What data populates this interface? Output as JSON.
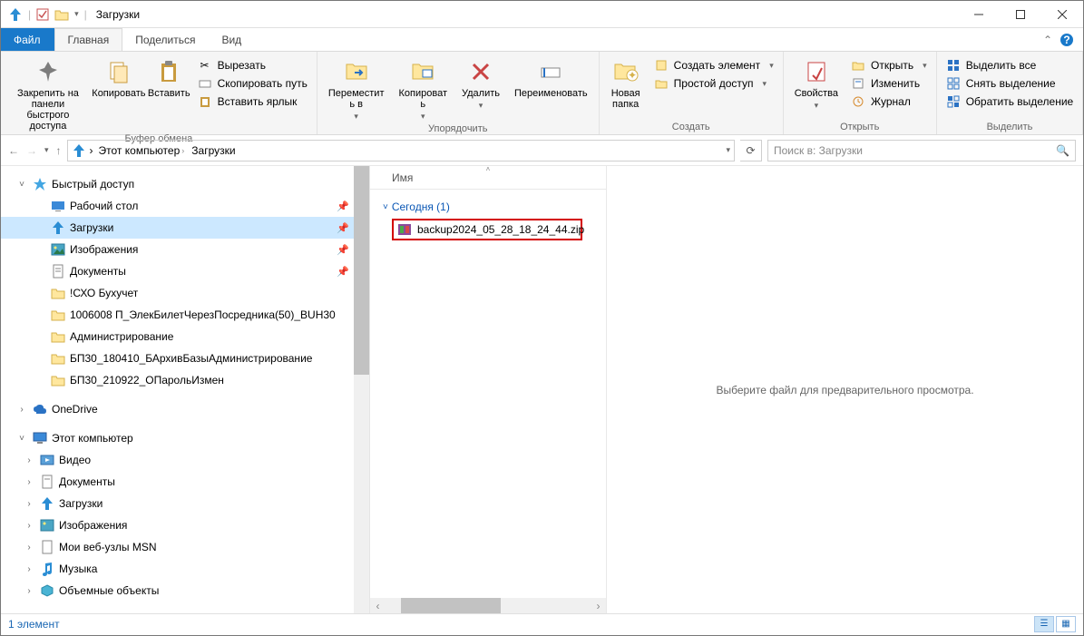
{
  "window": {
    "title": "Загрузки"
  },
  "tabs": {
    "file": "Файл",
    "home": "Главная",
    "share": "Поделиться",
    "view": "Вид"
  },
  "ribbon": {
    "g1": {
      "label": "Буфер обмена",
      "pin": "Закрепить на панели\nбыстрого доступа",
      "copy": "Копировать",
      "paste": "Вставить",
      "cut": "Вырезать",
      "copypath": "Скопировать путь",
      "pasteshortcut": "Вставить ярлык"
    },
    "g2": {
      "label": "Упорядочить",
      "moveto": "Переместит\nь в",
      "copyto": "Копироват\nь",
      "delete": "Удалить",
      "rename": "Переименовать"
    },
    "g3": {
      "label": "Создать",
      "newfolder": "Новая\nпапка",
      "newitem": "Создать элемент",
      "easyaccess": "Простой доступ"
    },
    "g4": {
      "label": "Открыть",
      "properties": "Свойства",
      "open": "Открыть",
      "edit": "Изменить",
      "history": "Журнал"
    },
    "g5": {
      "label": "Выделить",
      "selectall": "Выделить все",
      "selectnone": "Снять выделение",
      "invertsel": "Обратить выделение"
    }
  },
  "addr": {
    "root": "Этот компьютер",
    "current": "Загрузки"
  },
  "search": {
    "placeholder": "Поиск в: Загрузки"
  },
  "tree": {
    "quick": "Быстрый доступ",
    "quick_items": [
      {
        "label": "Рабочий стол",
        "pinned": true
      },
      {
        "label": "Загрузки",
        "pinned": true,
        "selected": true
      },
      {
        "label": "Изображения",
        "pinned": true
      },
      {
        "label": "Документы",
        "pinned": true
      },
      {
        "label": "!СХО Бухучет"
      },
      {
        "label": "1006008 П_ЭлекБилетЧерезПосредника(50)_BUH30"
      },
      {
        "label": "Администрирование"
      },
      {
        "label": "БП30_180410_БАрхивБазыАдминистрирование"
      },
      {
        "label": "БП30_210922_ОПарольИзмен"
      }
    ],
    "onedrive": "OneDrive",
    "thispc": "Этот компьютер",
    "pc_items": [
      {
        "label": "Видео"
      },
      {
        "label": "Документы"
      },
      {
        "label": "Загрузки"
      },
      {
        "label": "Изображения"
      },
      {
        "label": "Мои веб-узлы MSN"
      },
      {
        "label": "Музыка"
      },
      {
        "label": "Объемные объекты"
      }
    ]
  },
  "filelist": {
    "col_name": "Имя",
    "group": "Сегодня (1)",
    "file1": "backup2024_05_28_18_24_44.zip"
  },
  "preview": {
    "text": "Выберите файл для предварительного просмотра."
  },
  "status": {
    "text": "1 элемент"
  }
}
